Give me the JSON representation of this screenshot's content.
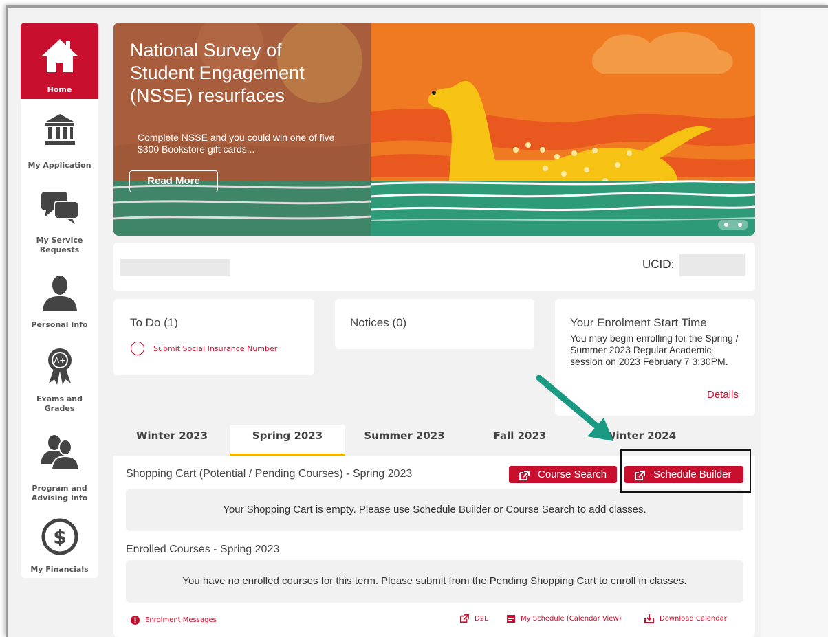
{
  "sidebar": {
    "items": [
      {
        "label": "Home",
        "icon": "home-icon"
      },
      {
        "label": "My Application",
        "icon": "institution-icon"
      },
      {
        "label": "My Service Requests",
        "icon": "chat-bubbles-icon"
      },
      {
        "label": "Personal Info",
        "icon": "person-icon"
      },
      {
        "label": "Exams and Grades",
        "icon": "award-ribbon-icon"
      },
      {
        "label": "Program and Advising Info",
        "icon": "people-icon"
      },
      {
        "label": "My Financials",
        "icon": "dollar-icon"
      }
    ]
  },
  "hero": {
    "title": "National Survey of Student Engagement (NSSE) resurfaces",
    "subtitle": "Complete NSSE and you could win one of five $300 Bookstore gift cards...",
    "button": "Read More"
  },
  "id_card": {
    "ucid_label": "UCID:"
  },
  "todo": {
    "title": "To Do (1)",
    "item": "Submit Social Insurance Number"
  },
  "notices": {
    "title": "Notices (0)"
  },
  "enrolment": {
    "title": "Your Enrolment Start Time",
    "body": "You may begin enrolling for the Spring / Summer 2023 Regular Academic session on 2023 February 7 3:30PM.",
    "details": "Details"
  },
  "tabs": [
    "Winter 2023",
    "Spring 2023",
    "Summer 2023",
    "Fall 2023",
    "Winter 2024"
  ],
  "active_tab": "Spring 2023",
  "cart": {
    "title": "Shopping Cart (Potential / Pending Courses) - Spring 2023",
    "course_search": "Course Search",
    "schedule_builder": "Schedule Builder",
    "empty": "Your Shopping Cart is empty. Please use Schedule Builder or Course Search to add classes."
  },
  "enrolled": {
    "title": "Enrolled Courses - Spring 2023",
    "empty": "You have no enrolled courses for this term. Please submit from the Pending Shopping Cart to enroll in classes."
  },
  "footer": {
    "messages": "Enrolment Messages",
    "d2l": "D2L",
    "schedule": "My Schedule (Calendar View)",
    "download": "Download Calendar"
  },
  "colors": {
    "accent": "#c8102e",
    "tab_underline": "#f0b400",
    "annotation_arrow": "#1a9a82"
  }
}
